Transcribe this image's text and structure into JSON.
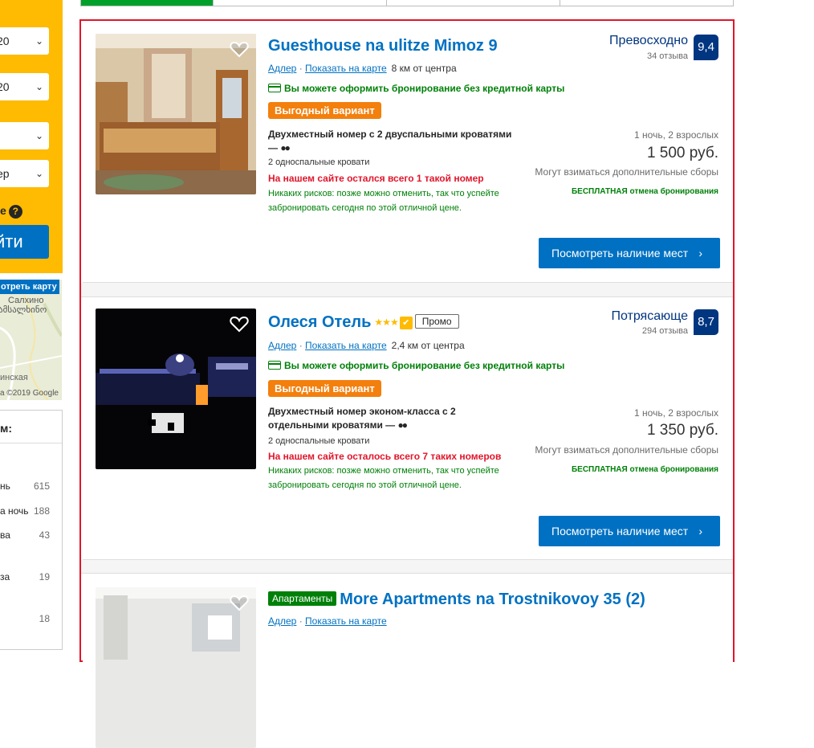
{
  "sidebar": {
    "selects": [
      {
        "value": "20"
      },
      {
        "value": "20"
      },
      {
        "value": ""
      },
      {
        "value": "ер"
      }
    ],
    "help_text": "е",
    "search_button": "йти",
    "map": {
      "show_on_map": "отреть карту",
      "place1": "Салхино",
      "place2": "ამსალხინო",
      "place3": "инская",
      "copyright": "а ©2019 Google"
    },
    "filter": {
      "title": "м:",
      "rows": [
        {
          "label": "нь",
          "count": "615"
        },
        {
          "label": "а ночь",
          "count": "188"
        },
        {
          "label": "ва",
          "count": "43"
        },
        {
          "label": "за",
          "count": "19"
        },
        {
          "label": "",
          "count": "18"
        }
      ]
    }
  },
  "listings": [
    {
      "title": "Guesthouse na ulitze Mimoz 9",
      "city_link": "Адлер",
      "map_link": "Показать на карте",
      "distance": "8 км от центра",
      "no_card": "Вы можете оформить бронирование без кредитной карты",
      "deal": "Выгодный вариант",
      "room": "Двухместный номер с 2 двуспальными кроватями",
      "room_dash": "—",
      "beds": "2 односпальные кровати",
      "rooms_left": "На нашем сайте остался всего 1 такой номер",
      "no_risk": "Никаких рисков: позже можно отменить, так что успейте забронировать сегодня по этой отличной цене.",
      "score_word": "Превосходно",
      "reviews": "34 отзыва",
      "score": "9,4",
      "nights": "1 ночь, 2 взрослых",
      "price": "1 500 руб.",
      "fees": "Могут взиматься дополнительные сборы",
      "free_cancel": "БЕСПЛАТНАЯ отмена бронирования",
      "cta": "Посмотреть наличие мест"
    },
    {
      "title": "Олеся Отель",
      "stars": "★★★",
      "promo": "Промо",
      "city_link": "Адлер",
      "map_link": "Показать на карте",
      "distance": "2,4 км от центра",
      "no_card": "Вы можете оформить бронирование без кредитной карты",
      "deal": "Выгодный вариант",
      "room": "Двухместный номер эконом-класса с 2 отдельными кроватями",
      "room_dash": "—",
      "beds": "2 односпальные кровати",
      "rooms_left": "На нашем сайте осталось всего 7 таких номеров",
      "no_risk": "Никаких рисков: позже можно отменить, так что успейте забронировать сегодня по этой отличной цене.",
      "score_word": "Потрясающе",
      "reviews": "294 отзыва",
      "score": "8,7",
      "nights": "1 ночь, 2 взрослых",
      "price": "1 350 руб.",
      "fees": "Могут взиматься дополнительные сборы",
      "free_cancel": "БЕСПЛАТНАЯ отмена бронирования",
      "cta": "Посмотреть наличие мест"
    },
    {
      "badge": "Апартаменты",
      "title": "More Apartments na Trostnikovoy 35 (2)",
      "city_link": "Адлер",
      "map_link": "Показать на карте"
    }
  ],
  "colors": {
    "brand_blue": "#0071c2",
    "dark_blue": "#003580",
    "yellow": "#febb02",
    "green": "#008009",
    "red": "#e0162b",
    "orange": "#f37f0d"
  }
}
